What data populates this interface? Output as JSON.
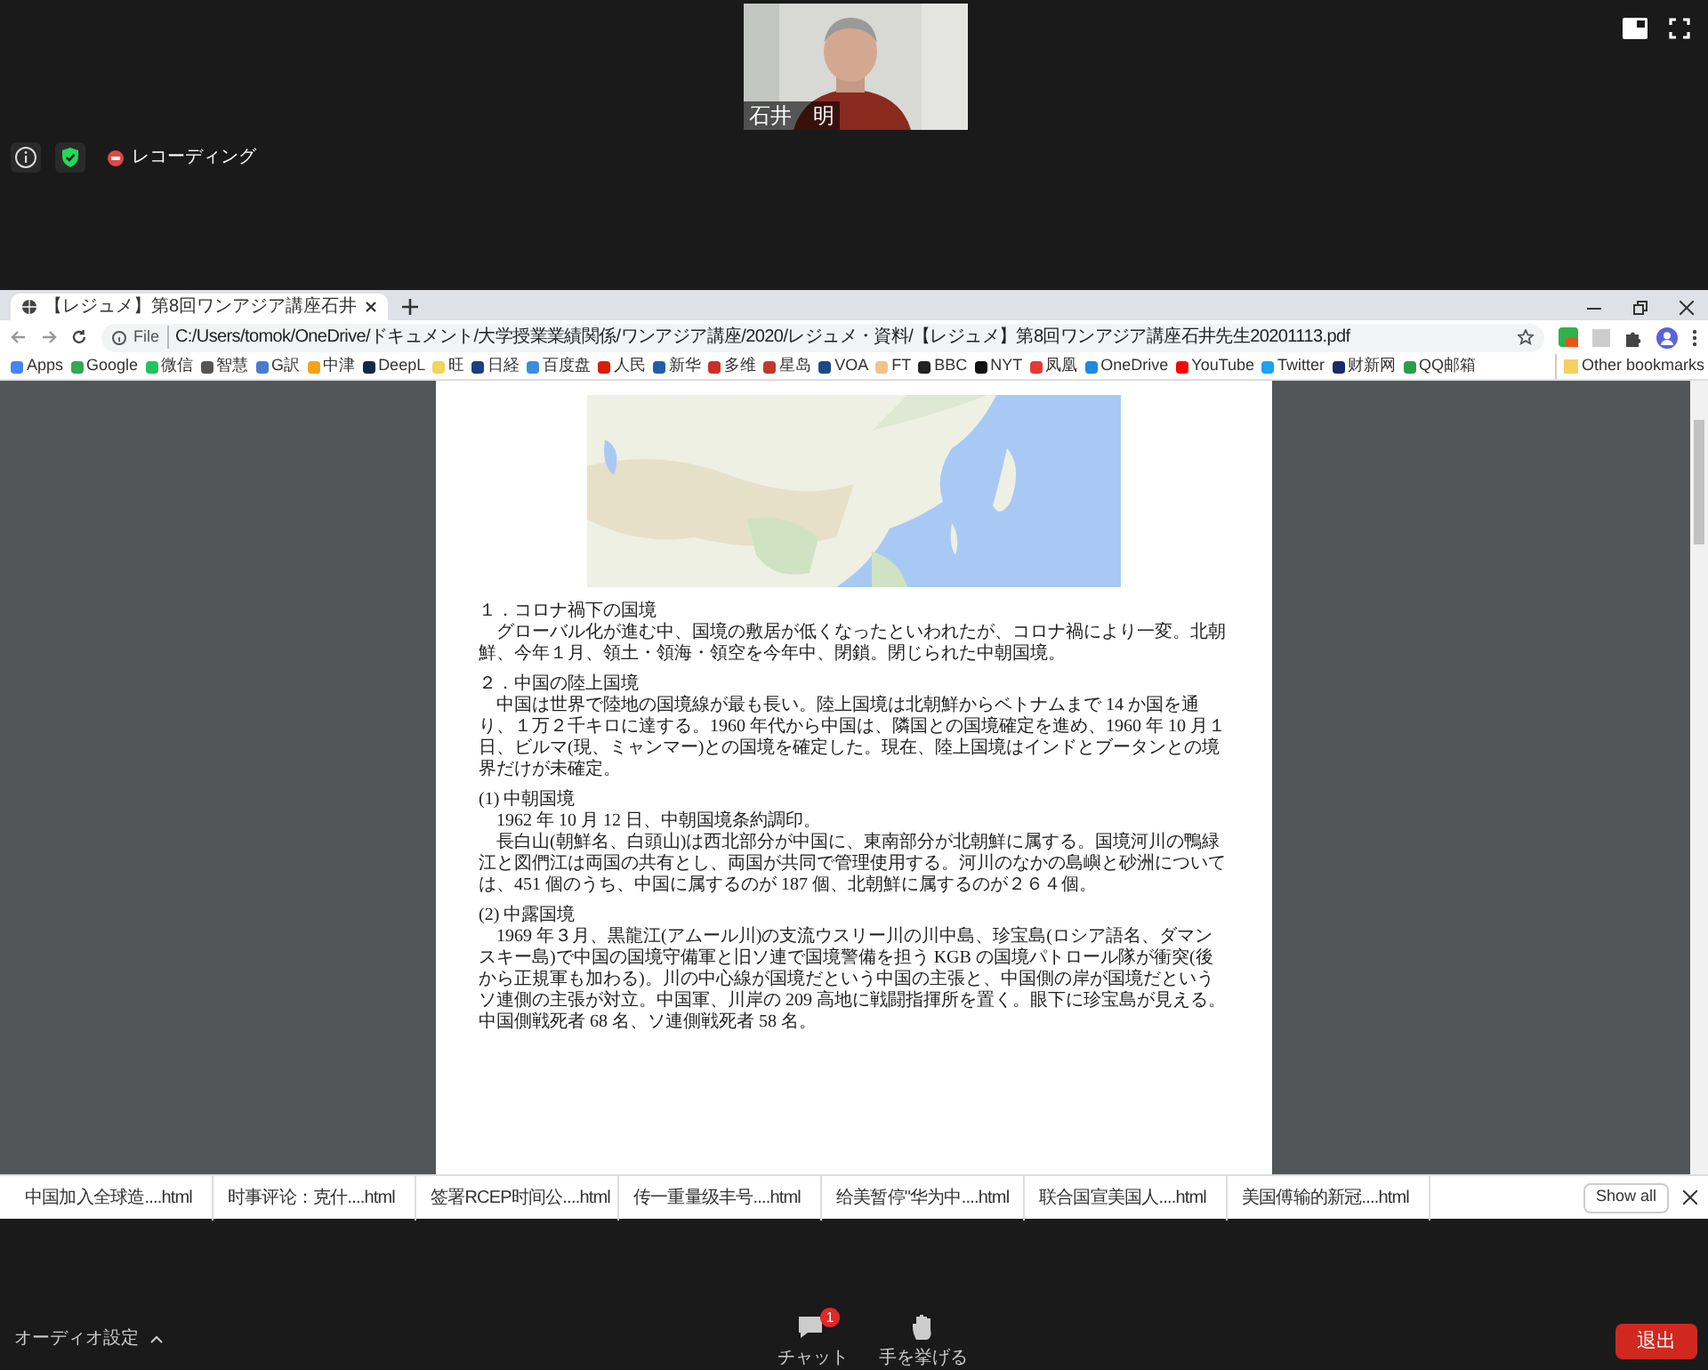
{
  "meeting": {
    "speaker": {
      "name": "石井　明"
    },
    "recording_label": "レコーディング"
  },
  "browser": {
    "tab": {
      "title": "【レジュメ】第8回ワンアジア講座石井"
    },
    "address": {
      "scheme": "File",
      "path": "C:/Users/tomok/OneDrive/ドキュメント/大学授業業績関係/ワンアジア講座/2020/レジュメ・資料/【レジュメ】第8回ワンアジア講座石井先生20201113.pdf"
    },
    "bookmarks": [
      {
        "label": "Apps",
        "color": "#4285f4"
      },
      {
        "label": "Google",
        "color": "#34a853"
      },
      {
        "label": "微信",
        "color": "#22c35e"
      },
      {
        "label": "智慧",
        "color": "#555555"
      },
      {
        "label": "G訳",
        "color": "#4a7bd0"
      },
      {
        "label": "中津",
        "color": "#f4a21c"
      },
      {
        "label": "DeepL",
        "color": "#0f2b46"
      },
      {
        "label": "旺",
        "color": "#f2d35b"
      },
      {
        "label": "日経",
        "color": "#1b3f80"
      },
      {
        "label": "百度盘",
        "color": "#3b8ede"
      },
      {
        "label": "人民",
        "color": "#d81e06"
      },
      {
        "label": "新华",
        "color": "#1f5fa8"
      },
      {
        "label": "多维",
        "color": "#c9302c"
      },
      {
        "label": "星岛",
        "color": "#c0392b"
      },
      {
        "label": "VOA",
        "color": "#1b4a8a"
      },
      {
        "label": "FT",
        "color": "#f2c48d"
      },
      {
        "label": "BBC",
        "color": "#222222"
      },
      {
        "label": "NYT",
        "color": "#111111"
      },
      {
        "label": "凤凰",
        "color": "#e53935"
      },
      {
        "label": "OneDrive",
        "color": "#1e88e5"
      },
      {
        "label": "YouTube",
        "color": "#ff0000"
      },
      {
        "label": "Twitter",
        "color": "#1da1f2"
      },
      {
        "label": "财新网",
        "color": "#1a2a6c"
      },
      {
        "label": "QQ邮箱",
        "color": "#2a9d4a"
      }
    ],
    "other_bookmarks": "Other bookmarks"
  },
  "document": {
    "sections": [
      {
        "heading": "１．コロナ禍下の国境",
        "paragraphs": [
          "グローバル化が進む中、国境の敷居が低くなったといわれたが、コロナ禍により一変。北朝鮮、今年１月、領土・領海・領空を今年中、閉鎖。閉じられた中朝国境。"
        ]
      },
      {
        "heading": "２．中国の陸上国境",
        "paragraphs": [
          "中国は世界で陸地の国境線が最も長い。陸上国境は北朝鮮からベトナムまで 14 か国を通り、１万２千キロに達する。1960 年代から中国は、隣国との国境確定を進め、1960 年 10 月１日、ビルマ(現、ミャンマー)との国境を確定した。現在、陸上国境はインドとブータンとの境界だけが未確定。"
        ]
      },
      {
        "heading": "(1) 中朝国境",
        "paragraphs": [
          "1962 年 10 月 12 日、中朝国境条約調印。",
          "長白山(朝鮮名、白頭山)は西北部分が中国に、東南部分が北朝鮮に属する。国境河川の鴨緑江と図們江は両国の共有とし、両国が共同で管理使用する。河川のなかの島嶼と砂洲については、451 個のうち、中国に属するのが 187 個、北朝鮮に属するのが２６４個。"
        ]
      },
      {
        "heading": "(2) 中露国境",
        "paragraphs": [
          "1969 年３月、黒龍江(アムール川)の支流ウスリー川の川中島、珍宝島(ロシア語名、ダマンスキー島)で中国の国境守備軍と旧ソ連で国境警備を担う KGB の国境パトロール隊が衝突(後から正規軍も加わる)。川の中心線が国境だという中国の主張と、中国側の岸が国境だというソ連側の主張が対立。中国軍、川岸の 209 高地に戦闘指揮所を置く。眼下に珍宝島が見える。中国側戦死者 68 名、ソ連側戦死者 58 名。"
        ]
      }
    ]
  },
  "downloads": {
    "items": [
      "中国加入全球造....html",
      "时事评论：克什....html",
      "签署RCEP时间公....html",
      "传一重量级丰号....html",
      "给美暂停\"华为中....html",
      "联合国宣美国人....html",
      "美国傅输的新冠....html"
    ],
    "show_all": "Show all"
  },
  "toolbar": {
    "audio_label": "オーディオ設定",
    "chat": {
      "label": "チャット",
      "badge": "1"
    },
    "raise_hand_label": "手を挙げる",
    "leave_label": "退出"
  }
}
